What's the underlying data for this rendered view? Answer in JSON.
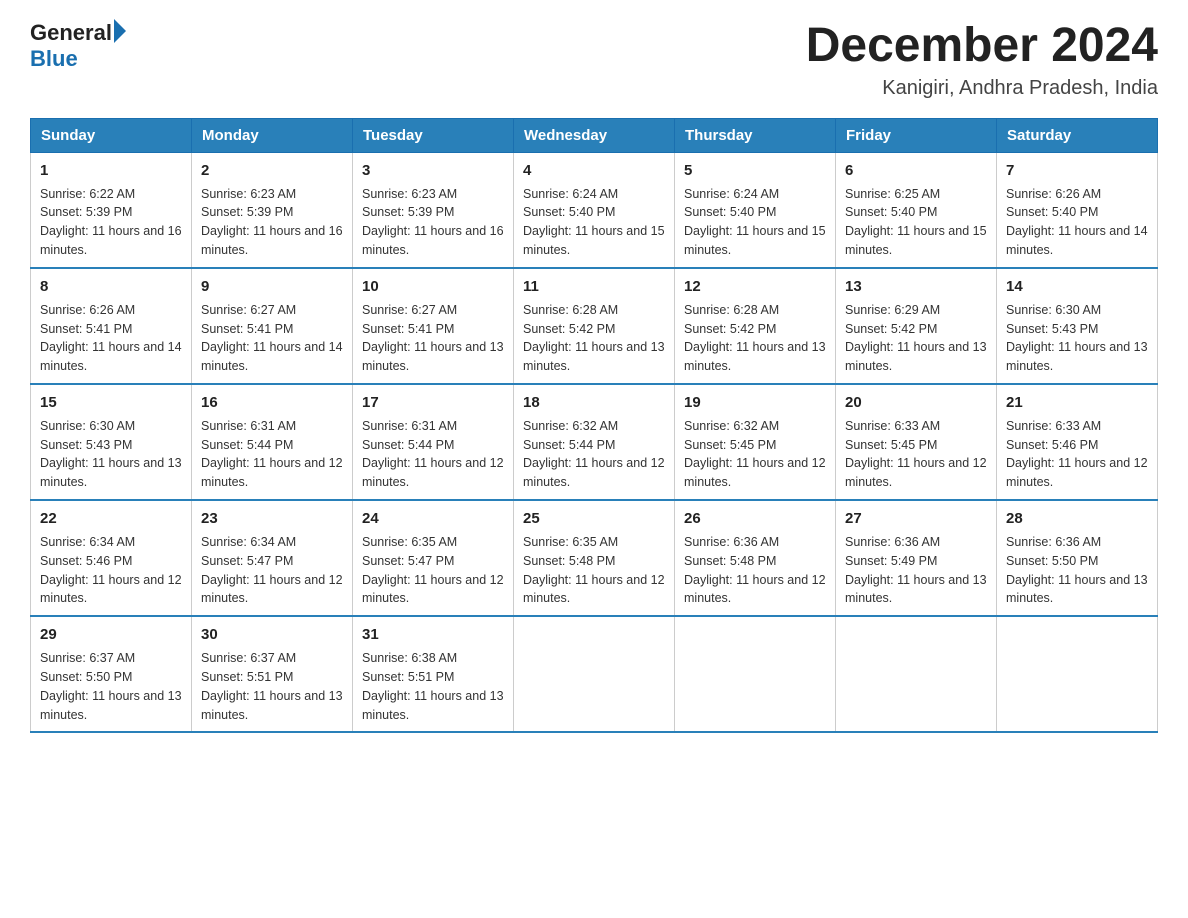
{
  "header": {
    "logo_general": "General",
    "logo_blue": "Blue",
    "month_title": "December 2024",
    "location": "Kanigiri, Andhra Pradesh, India"
  },
  "days_of_week": [
    "Sunday",
    "Monday",
    "Tuesday",
    "Wednesday",
    "Thursday",
    "Friday",
    "Saturday"
  ],
  "weeks": [
    [
      {
        "day": "1",
        "sunrise": "6:22 AM",
        "sunset": "5:39 PM",
        "daylight": "11 hours and 16 minutes."
      },
      {
        "day": "2",
        "sunrise": "6:23 AM",
        "sunset": "5:39 PM",
        "daylight": "11 hours and 16 minutes."
      },
      {
        "day": "3",
        "sunrise": "6:23 AM",
        "sunset": "5:39 PM",
        "daylight": "11 hours and 16 minutes."
      },
      {
        "day": "4",
        "sunrise": "6:24 AM",
        "sunset": "5:40 PM",
        "daylight": "11 hours and 15 minutes."
      },
      {
        "day": "5",
        "sunrise": "6:24 AM",
        "sunset": "5:40 PM",
        "daylight": "11 hours and 15 minutes."
      },
      {
        "day": "6",
        "sunrise": "6:25 AM",
        "sunset": "5:40 PM",
        "daylight": "11 hours and 15 minutes."
      },
      {
        "day": "7",
        "sunrise": "6:26 AM",
        "sunset": "5:40 PM",
        "daylight": "11 hours and 14 minutes."
      }
    ],
    [
      {
        "day": "8",
        "sunrise": "6:26 AM",
        "sunset": "5:41 PM",
        "daylight": "11 hours and 14 minutes."
      },
      {
        "day": "9",
        "sunrise": "6:27 AM",
        "sunset": "5:41 PM",
        "daylight": "11 hours and 14 minutes."
      },
      {
        "day": "10",
        "sunrise": "6:27 AM",
        "sunset": "5:41 PM",
        "daylight": "11 hours and 13 minutes."
      },
      {
        "day": "11",
        "sunrise": "6:28 AM",
        "sunset": "5:42 PM",
        "daylight": "11 hours and 13 minutes."
      },
      {
        "day": "12",
        "sunrise": "6:28 AM",
        "sunset": "5:42 PM",
        "daylight": "11 hours and 13 minutes."
      },
      {
        "day": "13",
        "sunrise": "6:29 AM",
        "sunset": "5:42 PM",
        "daylight": "11 hours and 13 minutes."
      },
      {
        "day": "14",
        "sunrise": "6:30 AM",
        "sunset": "5:43 PM",
        "daylight": "11 hours and 13 minutes."
      }
    ],
    [
      {
        "day": "15",
        "sunrise": "6:30 AM",
        "sunset": "5:43 PM",
        "daylight": "11 hours and 13 minutes."
      },
      {
        "day": "16",
        "sunrise": "6:31 AM",
        "sunset": "5:44 PM",
        "daylight": "11 hours and 12 minutes."
      },
      {
        "day": "17",
        "sunrise": "6:31 AM",
        "sunset": "5:44 PM",
        "daylight": "11 hours and 12 minutes."
      },
      {
        "day": "18",
        "sunrise": "6:32 AM",
        "sunset": "5:44 PM",
        "daylight": "11 hours and 12 minutes."
      },
      {
        "day": "19",
        "sunrise": "6:32 AM",
        "sunset": "5:45 PM",
        "daylight": "11 hours and 12 minutes."
      },
      {
        "day": "20",
        "sunrise": "6:33 AM",
        "sunset": "5:45 PM",
        "daylight": "11 hours and 12 minutes."
      },
      {
        "day": "21",
        "sunrise": "6:33 AM",
        "sunset": "5:46 PM",
        "daylight": "11 hours and 12 minutes."
      }
    ],
    [
      {
        "day": "22",
        "sunrise": "6:34 AM",
        "sunset": "5:46 PM",
        "daylight": "11 hours and 12 minutes."
      },
      {
        "day": "23",
        "sunrise": "6:34 AM",
        "sunset": "5:47 PM",
        "daylight": "11 hours and 12 minutes."
      },
      {
        "day": "24",
        "sunrise": "6:35 AM",
        "sunset": "5:47 PM",
        "daylight": "11 hours and 12 minutes."
      },
      {
        "day": "25",
        "sunrise": "6:35 AM",
        "sunset": "5:48 PM",
        "daylight": "11 hours and 12 minutes."
      },
      {
        "day": "26",
        "sunrise": "6:36 AM",
        "sunset": "5:48 PM",
        "daylight": "11 hours and 12 minutes."
      },
      {
        "day": "27",
        "sunrise": "6:36 AM",
        "sunset": "5:49 PM",
        "daylight": "11 hours and 13 minutes."
      },
      {
        "day": "28",
        "sunrise": "6:36 AM",
        "sunset": "5:50 PM",
        "daylight": "11 hours and 13 minutes."
      }
    ],
    [
      {
        "day": "29",
        "sunrise": "6:37 AM",
        "sunset": "5:50 PM",
        "daylight": "11 hours and 13 minutes."
      },
      {
        "day": "30",
        "sunrise": "6:37 AM",
        "sunset": "5:51 PM",
        "daylight": "11 hours and 13 minutes."
      },
      {
        "day": "31",
        "sunrise": "6:38 AM",
        "sunset": "5:51 PM",
        "daylight": "11 hours and 13 minutes."
      },
      {
        "day": "",
        "sunrise": "",
        "sunset": "",
        "daylight": ""
      },
      {
        "day": "",
        "sunrise": "",
        "sunset": "",
        "daylight": ""
      },
      {
        "day": "",
        "sunrise": "",
        "sunset": "",
        "daylight": ""
      },
      {
        "day": "",
        "sunrise": "",
        "sunset": "",
        "daylight": ""
      }
    ]
  ]
}
